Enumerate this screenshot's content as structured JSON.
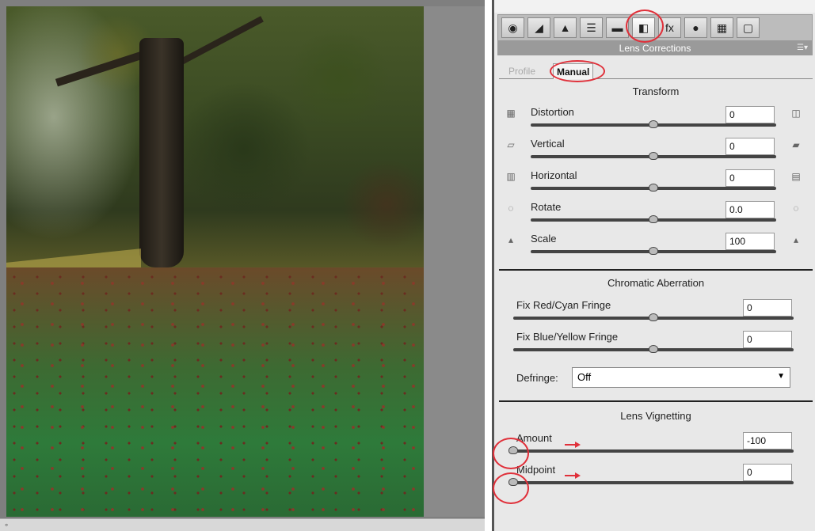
{
  "toolbar": {
    "tools": [
      {
        "icon": "basic-icon",
        "glyph": "◉"
      },
      {
        "icon": "tone-curve-icon",
        "glyph": "◢"
      },
      {
        "icon": "detail-icon",
        "glyph": "▲"
      },
      {
        "icon": "hsl-icon",
        "glyph": "☰"
      },
      {
        "icon": "split-toning-icon",
        "glyph": "▬"
      },
      {
        "icon": "lens-corrections-icon",
        "glyph": "◧"
      },
      {
        "icon": "effects-icon",
        "glyph": "fx"
      },
      {
        "icon": "camera-calibration-icon",
        "glyph": "●"
      },
      {
        "icon": "presets-icon",
        "glyph": "▦"
      },
      {
        "icon": "snapshots-icon",
        "glyph": "▢"
      }
    ],
    "active_index": 5
  },
  "panel": {
    "title": "Lens Corrections",
    "tabs": [
      "Profile",
      "Manual"
    ]
  },
  "transform": {
    "title": "Transform",
    "rows": [
      {
        "label": "Distortion",
        "value": "0",
        "slider": 0.5
      },
      {
        "label": "Vertical",
        "value": "0",
        "slider": 0.5
      },
      {
        "label": "Horizontal",
        "value": "0",
        "slider": 0.5
      },
      {
        "label": "Rotate",
        "value": "0.0",
        "slider": 0.5
      },
      {
        "label": "Scale",
        "value": "100",
        "slider": 0.5
      }
    ]
  },
  "chromatic": {
    "title": "Chromatic Aberration",
    "rows": [
      {
        "label": "Fix Red/Cyan Fringe",
        "value": "0",
        "slider": 0.5
      },
      {
        "label": "Fix Blue/Yellow Fringe",
        "value": "0",
        "slider": 0.5
      }
    ],
    "defringe_label": "Defringe:",
    "defringe_value": "Off"
  },
  "vignetting": {
    "title": "Lens Vignetting",
    "rows": [
      {
        "label": "Amount",
        "value": "-100",
        "slider": 0.0
      },
      {
        "label": "Midpoint",
        "value": "0",
        "slider": 0.0
      }
    ]
  },
  "annotation_color": "#e0303a"
}
